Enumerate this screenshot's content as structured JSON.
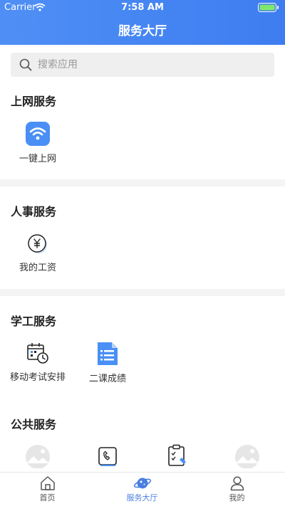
{
  "status_bar": {
    "carrier": "Carrier",
    "time": "7:58 AM"
  },
  "header": {
    "title": "服务大厅"
  },
  "search": {
    "placeholder": "搜索应用"
  },
  "sections": [
    {
      "title": "上网服务",
      "items": [
        {
          "label": "一键上网",
          "icon": "wifi-icon"
        }
      ]
    },
    {
      "title": "人事服务",
      "items": [
        {
          "label": "我的工资",
          "icon": "yuan-icon"
        }
      ]
    },
    {
      "title": "学工服务",
      "items": [
        {
          "label": "移动考试安排",
          "icon": "calendar-clock-icon"
        },
        {
          "label": "二课成绩",
          "icon": "document-icon"
        }
      ]
    },
    {
      "title": "公共服务",
      "items": [
        {
          "icon": "image-placeholder-icon"
        },
        {
          "icon": "phone-card-icon"
        },
        {
          "icon": "clipboard-check-icon"
        },
        {
          "icon": "image-placeholder-icon"
        }
      ]
    }
  ],
  "tabbar": {
    "items": [
      {
        "label": "首页",
        "icon": "home-icon"
      },
      {
        "label": "服务大厅",
        "icon": "planet-icon",
        "active": true
      },
      {
        "label": "我的",
        "icon": "user-icon"
      }
    ]
  },
  "colors": {
    "header": "#3d7df0",
    "accent": "#4a7fe0",
    "wifi_tile": "#4a8ff5",
    "divider": "#f4f4f4"
  }
}
